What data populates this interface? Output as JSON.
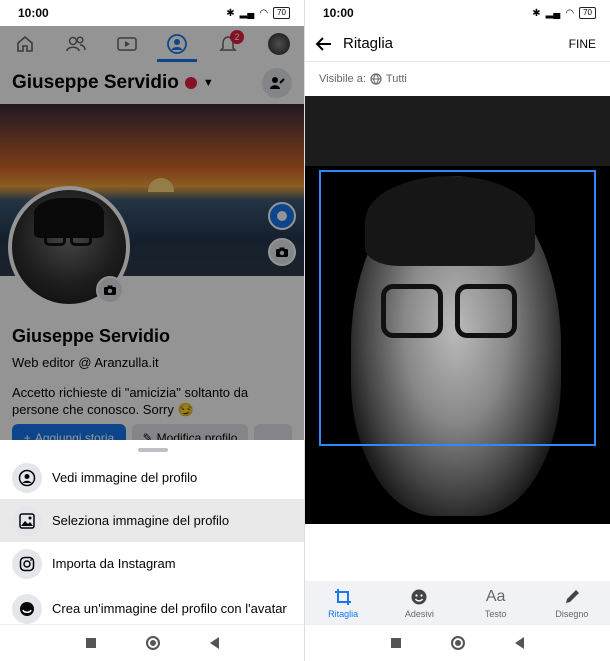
{
  "left_screen": {
    "status": {
      "time": "10:00",
      "battery": "70"
    },
    "tabs": [
      "home",
      "friends",
      "watch",
      "profile",
      "notifications",
      "menu"
    ],
    "notification_count": "2",
    "profile_header": {
      "name": "Giuseppe Servidio"
    },
    "profile": {
      "name": "Giuseppe Servidio",
      "role": "Web editor @ Aranzulla.it",
      "bio": "Accetto richieste di \"amicizia\" soltanto da persone che conosco. Sorry 😏"
    },
    "actions": {
      "add_story": "Aggiungi storia",
      "edit_profile": "Modifica profilo",
      "more": "..."
    },
    "sheet": {
      "items": [
        {
          "label": "Vedi immagine del profilo",
          "icon": "user-circle-icon"
        },
        {
          "label": "Seleziona immagine del profilo",
          "icon": "image-icon"
        },
        {
          "label": "Importa da Instagram",
          "icon": "instagram-icon"
        },
        {
          "label": "Crea un'immagine del profilo con l'avatar",
          "icon": "avatar-icon"
        }
      ]
    }
  },
  "right_screen": {
    "status": {
      "time": "10:00",
      "battery": "70"
    },
    "header": {
      "title": "Ritaglia",
      "done": "FINE"
    },
    "visibility": {
      "label": "Visibile a:",
      "value": "Tutti"
    },
    "tools": [
      {
        "label": "Ritaglia",
        "icon": "crop-icon",
        "active": true
      },
      {
        "label": "Adesivi",
        "icon": "sticker-icon",
        "active": false
      },
      {
        "label": "Testo",
        "icon": "text-icon",
        "glyph": "Aa",
        "active": false
      },
      {
        "label": "Disegno",
        "icon": "pencil-icon",
        "active": false
      }
    ]
  },
  "colors": {
    "accent": "#1877f2",
    "crop_frame": "#2d88ff",
    "badge": "#e41e3f"
  }
}
